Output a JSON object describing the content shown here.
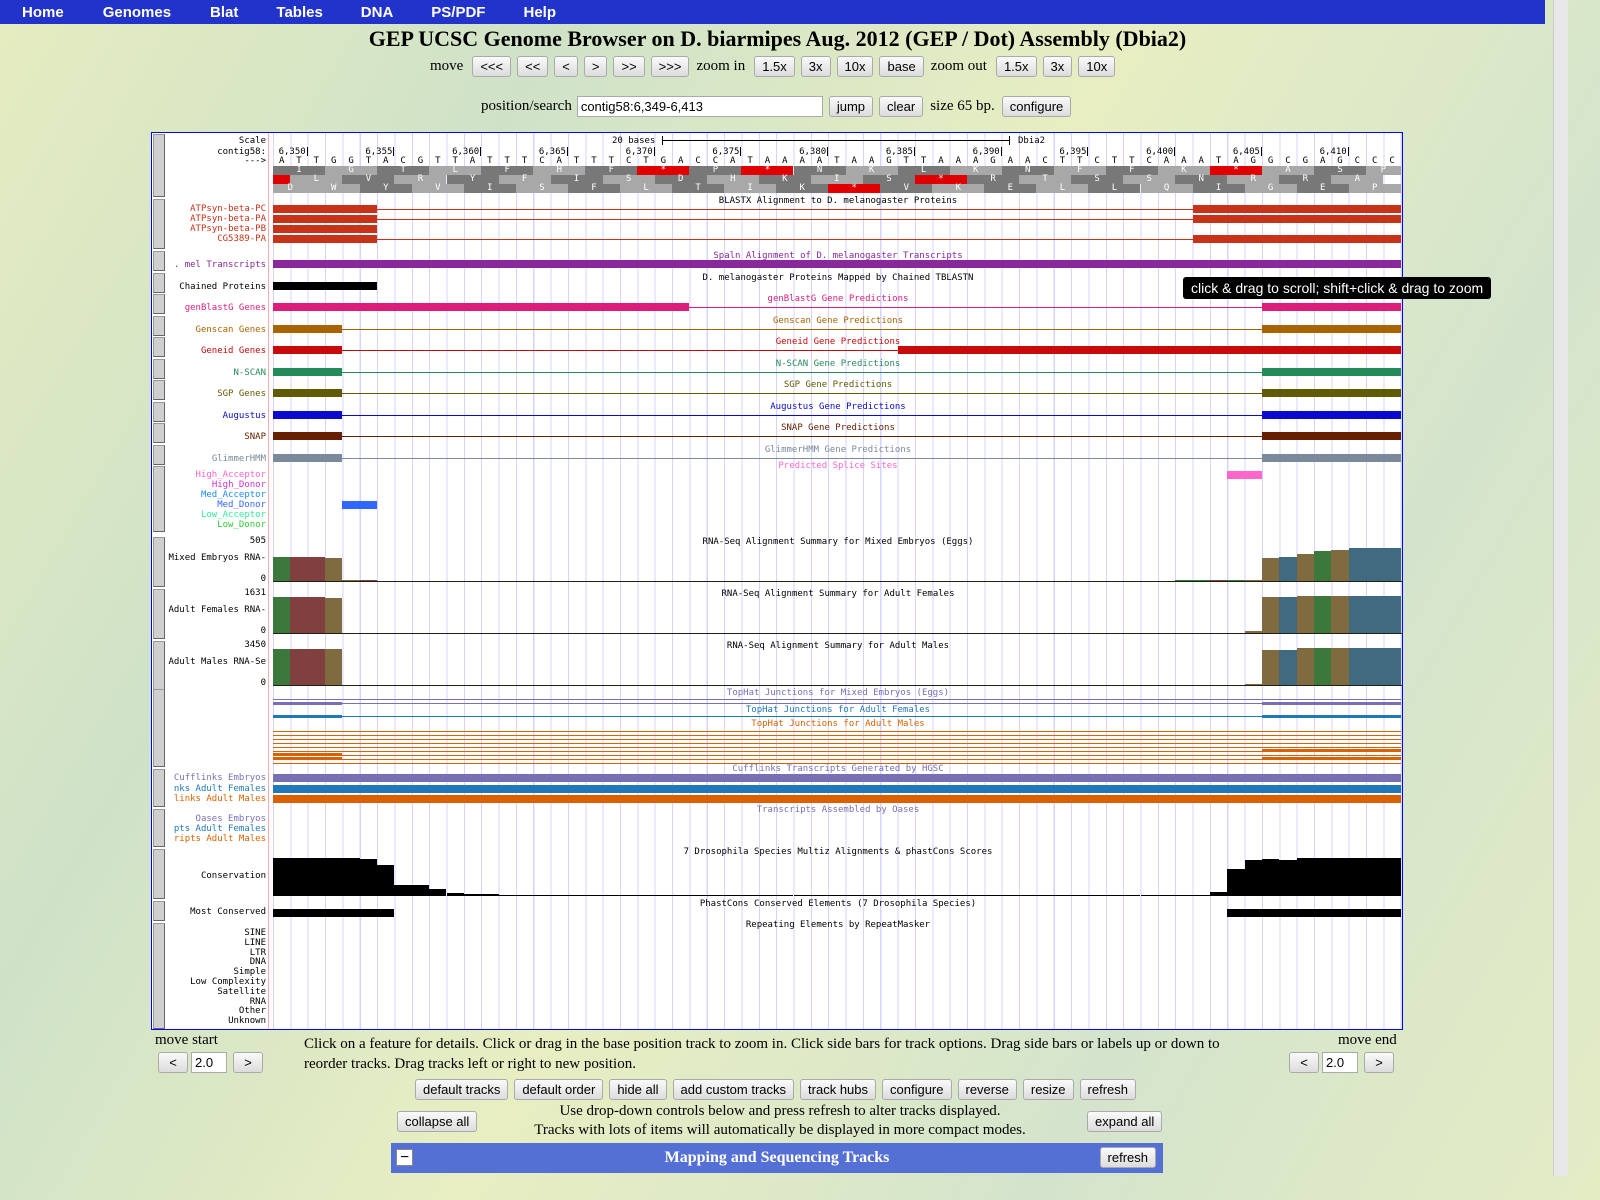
{
  "nav": [
    "Home",
    "Genomes",
    "Blat",
    "Tables",
    "DNA",
    "PS/PDF",
    "Help"
  ],
  "title": "GEP UCSC Genome Browser on D. biarmipes Aug. 2012 (GEP / Dot) Assembly (Dbia2)",
  "move": {
    "label": "move",
    "buttons": [
      "<<<",
      "<<",
      "<",
      ">",
      ">>",
      ">>>"
    ]
  },
  "zoom_in": {
    "label": "zoom in",
    "buttons": [
      "1.5x",
      "3x",
      "10x",
      "base"
    ]
  },
  "zoom_out": {
    "label": "zoom out",
    "buttons": [
      "1.5x",
      "3x",
      "10x"
    ]
  },
  "search": {
    "label": "position/search",
    "value": "contig58:6,349-6,413",
    "jump": "jump",
    "clear": "clear",
    "size": "size 65 bp.",
    "configure": "configure"
  },
  "region": {
    "start": 6349,
    "end": 6413,
    "chrom": "contig58"
  },
  "ruler": {
    "scale_label": "Scale",
    "chrom_label": "contig58:",
    "strand_label": "--->",
    "scale_bar": "20 bases",
    "assembly": "Dbia2",
    "ticks": [
      "6,350",
      "6,355",
      "6,360",
      "6,365",
      "6,370",
      "6,375",
      "6,380",
      "6,385",
      "6,390",
      "6,395",
      "6,400",
      "6,405",
      "6,410"
    ],
    "sequence": "ATTGGTACGTTATTTCATTTCTGACCATAAAATAAGTTAAAGAACTTCTTCAAATAGGCGAGCCC",
    "frames": [
      {
        "offset": 0,
        "aa": "IGTLFHF*P*NKLKNFFK*ASP"
      },
      {
        "offset": 1,
        "lead": "*",
        "aa": "LVRYFIS DHKIS*RTSSNRRA"
      },
      {
        "offset": 2,
        "lead": "D",
        "aa": "WYVISFLTIK*VKELLQIGEP"
      }
    ]
  },
  "colors": {
    "blastx": "#c83218",
    "spaln": "#88289a",
    "chained": "#000000",
    "genblastg": "#dd1d7a",
    "genscan": "#a86400",
    "geneid": "#c80a0a",
    "nscan": "#248a5a",
    "sgp": "#605a00",
    "augustus": "#0a0acc",
    "snap": "#642000",
    "glimmer": "#7a8a9a",
    "base_A": "#3c783c",
    "base_T": "#804040",
    "base_G": "#806a40",
    "base_C": "#406a80",
    "tophat_emb": "#7870b4",
    "tophat_fem": "#2078b8",
    "tophat_male": "#dc6000"
  },
  "tracks": {
    "blastx": {
      "title": "BLASTX Alignment to D. melanogaster Proteins",
      "rows": [
        {
          "label": "ATPsyn-beta-PC",
          "blocks": [
            [
              6349,
              6354
            ],
            [
              6402,
              6413
            ]
          ],
          "line": [
            6349,
            6413
          ]
        },
        {
          "label": "ATPsyn-beta-PA",
          "blocks": [
            [
              6349,
              6354
            ],
            [
              6402,
              6413
            ]
          ],
          "line": [
            6349,
            6413
          ]
        },
        {
          "label": "ATPsyn-beta-PB",
          "blocks": [
            [
              6349,
              6354
            ]
          ],
          "line": null
        },
        {
          "label": "CG5389-PA",
          "blocks": [
            [
              6349,
              6354
            ],
            [
              6402,
              6413
            ]
          ],
          "line": [
            6349,
            6413
          ]
        }
      ]
    },
    "spaln": {
      "title": "Spaln Alignment of D. melanogaster Transcripts",
      "label": ". mel Transcripts",
      "blocks": [
        [
          6349,
          6413
        ]
      ]
    },
    "chained": {
      "title": "D. melanogaster Proteins Mapped by Chained TBLASTN",
      "label": "Chained Proteins",
      "blocks": [
        [
          6349,
          6354
        ]
      ]
    },
    "genblastg": {
      "title": "genBlastG Gene Predictions",
      "label": "genBlastG Genes",
      "blocks": [
        [
          6349,
          6372
        ],
        [
          6406,
          6413
        ]
      ]
    },
    "genscan": {
      "title": "Genscan Gene Predictions",
      "label": "Genscan Genes",
      "blocks": [
        [
          6349,
          6352
        ],
        [
          6406,
          6413
        ]
      ]
    },
    "geneid": {
      "title": "Geneid Gene Predictions",
      "label": "Geneid Genes",
      "blocks": [
        [
          6349,
          6352
        ],
        [
          6385,
          6413
        ]
      ]
    },
    "nscan": {
      "title": "N-SCAN Gene Predictions",
      "label": "N-SCAN",
      "blocks": [
        [
          6349,
          6352
        ],
        [
          6406,
          6413
        ]
      ]
    },
    "sgp": {
      "title": "SGP Gene Predictions",
      "label": "SGP Genes",
      "blocks": [
        [
          6349,
          6352
        ],
        [
          6406,
          6413
        ]
      ]
    },
    "augustus": {
      "title": "Augustus Gene Predictions",
      "label": "Augustus",
      "blocks": [
        [
          6349,
          6352
        ],
        [
          6406,
          6413
        ]
      ]
    },
    "snap": {
      "title": "SNAP Gene Predictions",
      "label": "SNAP",
      "blocks": [
        [
          6349,
          6352
        ],
        [
          6406,
          6413
        ]
      ]
    },
    "glimmer": {
      "title": "GlimmerHMM Gene Predictions",
      "label": "GlimmerHMM",
      "blocks": [
        [
          6349,
          6352
        ],
        [
          6406,
          6413
        ]
      ]
    },
    "splice": {
      "title": "Predicted Splice Sites",
      "rows": [
        {
          "label": "High_Acceptor",
          "color": "#ff66cc",
          "blocks": [
            [
              6404,
              6405
            ]
          ]
        },
        {
          "label": "High_Donor",
          "color": "#cc33cc",
          "blocks": []
        },
        {
          "label": "Med_Acceptor",
          "color": "#1a8cff",
          "blocks": []
        },
        {
          "label": "Med_Donor",
          "color": "#3366ff",
          "blocks": [
            [
              6353,
              6354
            ]
          ]
        },
        {
          "label": "Low_Acceptor",
          "color": "#33ee99",
          "blocks": []
        },
        {
          "label": "Low_Donor",
          "color": "#33cc33",
          "blocks": []
        }
      ]
    },
    "rnaseq": [
      {
        "title": "RNA-Seq Alignment Summary for Mixed Embryos (Eggs)",
        "label": "Mixed Embryos RNA-",
        "max": "505",
        "min": "0",
        "maxv": 505,
        "values": [
          [
            6349,
            275
          ],
          [
            6350,
            275
          ],
          [
            6351,
            275
          ],
          [
            6352,
            268
          ],
          [
            6353,
            5
          ],
          [
            6354,
            5
          ],
          [
            6401,
            2
          ],
          [
            6402,
            2
          ],
          [
            6403,
            2
          ],
          [
            6404,
            2
          ],
          [
            6405,
            3
          ],
          [
            6406,
            265
          ],
          [
            6407,
            280
          ],
          [
            6408,
            315
          ],
          [
            6409,
            340
          ],
          [
            6410,
            355
          ],
          [
            6411,
            383
          ],
          [
            6412,
            383
          ],
          [
            6413,
            383
          ]
        ]
      },
      {
        "title": "RNA-Seq Alignment Summary for Adult Females",
        "label": "Adult Females RNA-",
        "max": "1631",
        "min": "0",
        "maxv": 1631,
        "values": [
          [
            6349,
            1330
          ],
          [
            6350,
            1330
          ],
          [
            6351,
            1330
          ],
          [
            6352,
            1310
          ],
          [
            6405,
            80
          ],
          [
            6406,
            1320
          ],
          [
            6407,
            1340
          ],
          [
            6408,
            1370
          ],
          [
            6409,
            1370
          ],
          [
            6410,
            1370
          ],
          [
            6411,
            1370
          ],
          [
            6412,
            1370
          ],
          [
            6413,
            1370
          ]
        ]
      },
      {
        "title": "RNA-Seq Alignment Summary for Adult Males",
        "label": "Adult Males RNA-Se",
        "max": "3450",
        "min": "0",
        "maxv": 3450,
        "values": [
          [
            6349,
            2830
          ],
          [
            6350,
            2830
          ],
          [
            6351,
            2830
          ],
          [
            6352,
            2830
          ],
          [
            6405,
            20
          ],
          [
            6406,
            2780
          ],
          [
            6407,
            2780
          ],
          [
            6408,
            2870
          ],
          [
            6409,
            2870
          ],
          [
            6410,
            2870
          ],
          [
            6411,
            2870
          ],
          [
            6412,
            2870
          ],
          [
            6413,
            2870
          ]
        ]
      }
    ],
    "tophat": [
      {
        "title": "TopHat Junctions for Mixed Embryos (Eggs)",
        "color": "#7870b4"
      },
      {
        "title": "TopHat Junctions for Adult Females",
        "color": "#2078b8"
      },
      {
        "title": "TopHat Junctions for Adult Males",
        "color": "#dc6000"
      }
    ],
    "cufflinks": {
      "title": "Cufflinks Transcripts Generated by HGSC",
      "rows": [
        {
          "label": "Cufflinks Embryos",
          "color": "#7870b4"
        },
        {
          "label": "nks Adult Females",
          "color": "#2078b8"
        },
        {
          "label": "links Adult Males",
          "color": "#dc6000"
        }
      ]
    },
    "oases": {
      "title": "Transcripts Assembled by Oases",
      "rows": [
        {
          "label": "Oases Embryos",
          "color": "#7870b4"
        },
        {
          "label": "pts Adult Females",
          "color": "#2078b8"
        },
        {
          "label": "ripts Adult Males",
          "color": "#dc6000"
        }
      ]
    },
    "conservation": {
      "title": "7 Drosophila Species Multiz Alignments & phastCons Scores",
      "label": "Conservation",
      "values": [
        1,
        1,
        1,
        1,
        1,
        0.97,
        0.82,
        0.3,
        0.3,
        0.18,
        0.08,
        0.05,
        0.05,
        0.03,
        0,
        0,
        0,
        0,
        0,
        0,
        0,
        0,
        0,
        0,
        0,
        0.02,
        0,
        0,
        0,
        0.02,
        0,
        0,
        0,
        0,
        0,
        0,
        0,
        0,
        0,
        0,
        0,
        0,
        0.02,
        0.02,
        0.02,
        0.02,
        0,
        0,
        0.02,
        0,
        0,
        0,
        0,
        0.02,
        0.1,
        0.72,
        0.95,
        0.97,
        0.95,
        1,
        1,
        1,
        1,
        1,
        1
      ]
    },
    "mostcons": {
      "title": "PhastCons Conserved Elements (7 Drosophila Species)",
      "label": "Most Conserved",
      "blocks": [
        [
          6349,
          6355
        ],
        [
          6404,
          6413
        ]
      ]
    },
    "repeat": {
      "title": "Repeating Elements by RepeatMasker",
      "labels": [
        "SINE",
        "LINE",
        "LTR",
        "DNA",
        "Simple",
        "Low Complexity",
        "Satellite",
        "RNA",
        "Other",
        "Unknown"
      ]
    }
  },
  "tooltip": "click & drag to scroll; shift+click & drag to zoom",
  "bottom": {
    "move_start": "move start",
    "move_end": "move end",
    "step_value": "2.0",
    "left": "<",
    "right": ">",
    "hint": "Click on a feature for details. Click or drag in the base position track to zoom in. Click side bars for track options. Drag side bars or labels up or down to reorder tracks. Drag tracks left or right to new position.",
    "buttons": [
      "default tracks",
      "default order",
      "hide all",
      "add custom tracks",
      "track hubs",
      "configure",
      "reverse",
      "resize",
      "refresh"
    ],
    "collapse": "collapse all",
    "expand": "expand all",
    "info1": "Use drop-down controls below and press refresh to alter tracks displayed.",
    "info2": "Tracks with lots of items will automatically be displayed in more compact modes.",
    "section": "Mapping and Sequencing Tracks",
    "section_toggle": "−",
    "section_refresh": "refresh"
  }
}
